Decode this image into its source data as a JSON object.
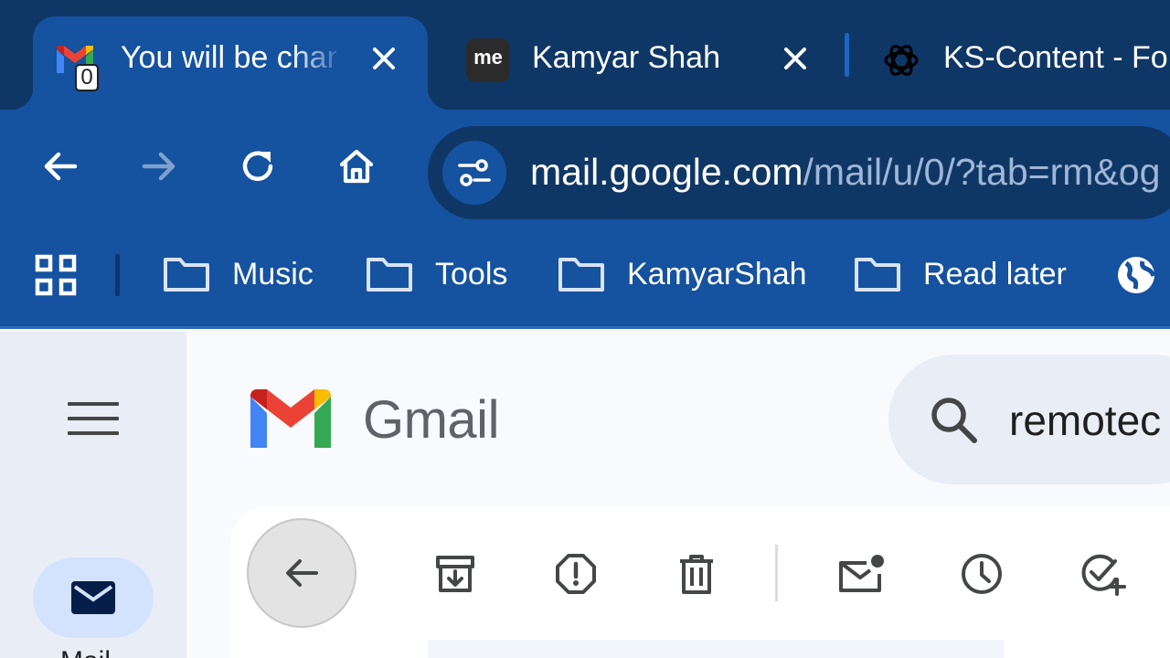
{
  "tabs": [
    {
      "title": "You will be changing",
      "favicon": "gmail-icon",
      "badge": "0",
      "active": true
    },
    {
      "title": "Kamyar Shah",
      "favicon": "me-icon",
      "favicon_text": "me",
      "active": false
    },
    {
      "title": "KS-Content - Fo",
      "favicon": "openai-icon",
      "active": false
    }
  ],
  "toolbar": {
    "url_host": "mail.google.com",
    "url_path": "/mail/u/0/?tab=rm&og"
  },
  "bookmarks": [
    {
      "label": "Music",
      "icon": "folder-icon"
    },
    {
      "label": "Tools",
      "icon": "folder-icon"
    },
    {
      "label": "KamyarShah",
      "icon": "folder-icon"
    },
    {
      "label": "Read later",
      "icon": "folder-icon"
    }
  ],
  "gmail": {
    "wordmark": "Gmail",
    "search_value": "remotec",
    "nav_mail_label": "Mail"
  },
  "colors": {
    "tabstrip": "#0f3766",
    "toolbar": "#15529f",
    "accent": "#d3e3fd"
  }
}
